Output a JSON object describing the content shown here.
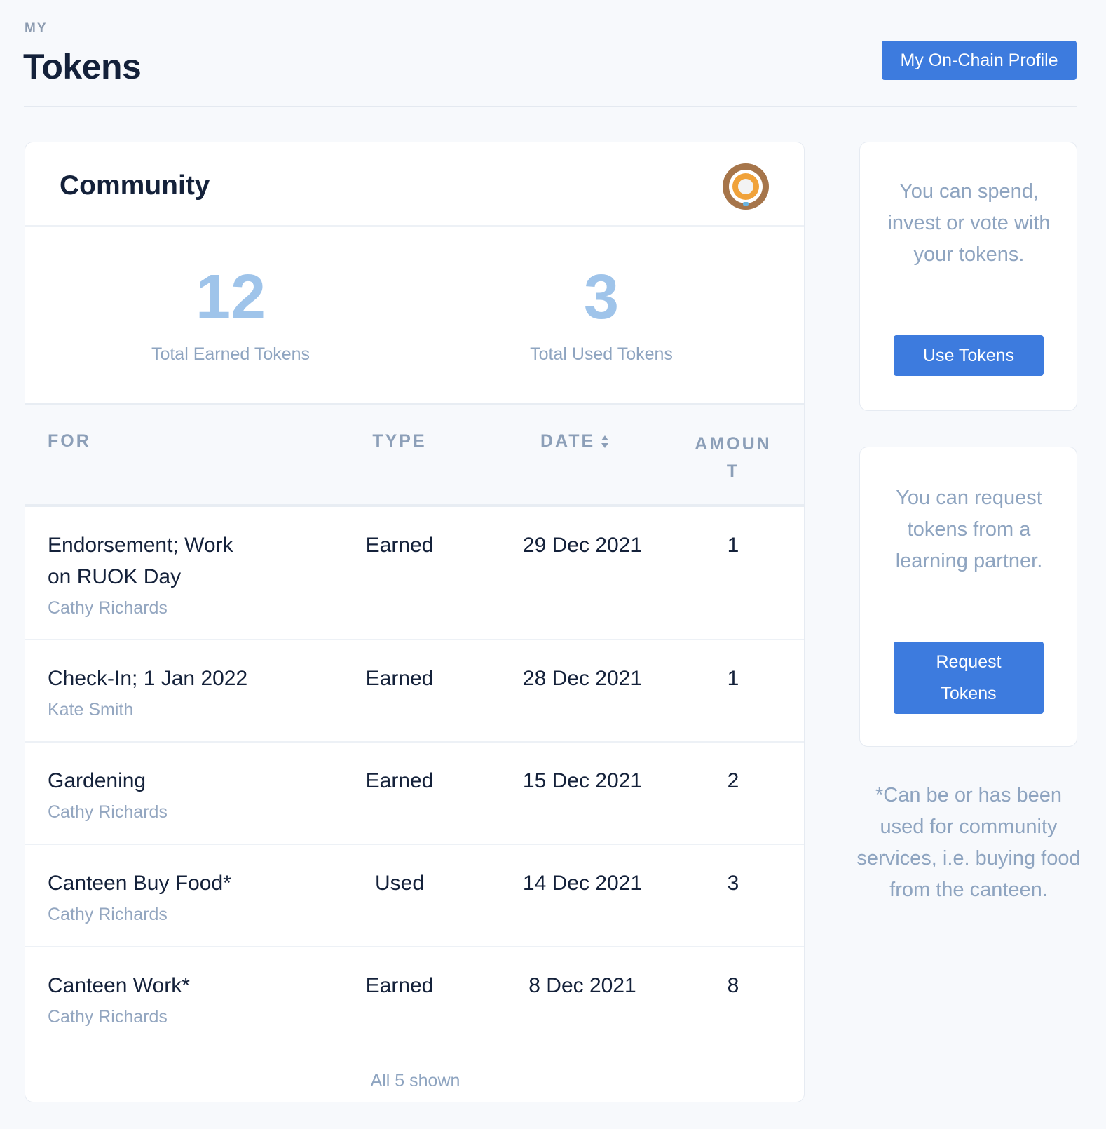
{
  "header": {
    "eyebrow": "MY",
    "title": "Tokens",
    "profile_button": "My On-Chain Profile"
  },
  "community": {
    "title": "Community",
    "logo_icon": "community-logo-icon",
    "stats": {
      "earned_value": "12",
      "earned_label": "Total Earned Tokens",
      "used_value": "3",
      "used_label": "Total Used Tokens"
    }
  },
  "table": {
    "columns": {
      "for": "FOR",
      "type": "TYPE",
      "date": "DATE",
      "amount": "AMOUNT"
    },
    "rows": [
      {
        "title": "Endorsement; Work on RUOK Day",
        "person": "Cathy Richards",
        "type": "Earned",
        "date": "29 Dec 2021",
        "amount": "1"
      },
      {
        "title": "Check-In; 1 Jan 2022",
        "person": "Kate Smith",
        "type": "Earned",
        "date": "28 Dec 2021",
        "amount": "1"
      },
      {
        "title": "Gardening",
        "person": "Cathy Richards",
        "type": "Earned",
        "date": "15 Dec 2021",
        "amount": "2"
      },
      {
        "title": "Canteen Buy Food*",
        "person": "Cathy Richards",
        "type": "Used",
        "date": "14 Dec 2021",
        "amount": "3"
      },
      {
        "title": "Canteen Work*",
        "person": "Cathy Richards",
        "type": "Earned",
        "date": "8 Dec 2021",
        "amount": "8"
      }
    ],
    "footer": "All 5 shown"
  },
  "sidebar": {
    "spend_text": "You can spend, invest or vote with your tokens.",
    "use_button": "Use Tokens",
    "request_text": "You can request tokens from a learning partner.",
    "request_button": "Request Tokens",
    "disclaimer": "*Can be or has been used for community services, i.e. buying food from the canteen."
  },
  "colors": {
    "accent": "#3d7bde",
    "stat_value": "#9fc4ea",
    "muted_text": "#8ea4c0",
    "logo_outer": "#a6754a",
    "logo_inner": "#f0a23a"
  }
}
